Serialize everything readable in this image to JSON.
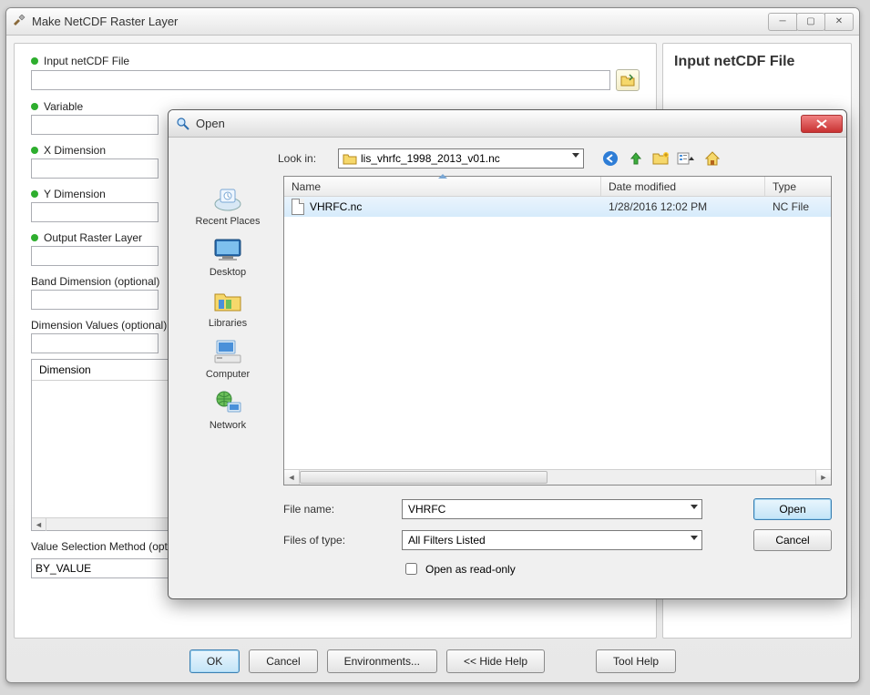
{
  "window": {
    "title": "Make NetCDF Raster Layer",
    "help_heading": "Input netCDF File"
  },
  "fields": {
    "input_file": {
      "label": "Input netCDF File",
      "value": ""
    },
    "variable": {
      "label": "Variable",
      "value": ""
    },
    "x_dim": {
      "label": "X Dimension",
      "value": ""
    },
    "y_dim": {
      "label": "Y Dimension",
      "value": ""
    },
    "output": {
      "label": "Output Raster Layer",
      "value": ""
    },
    "band_dim": {
      "label": "Band Dimension (optional)",
      "value": ""
    },
    "dim_values": {
      "label": "Dimension Values (optional)",
      "value": ""
    },
    "dim_header": "Dimension",
    "sel_method": {
      "label": "Value Selection Method (optional)",
      "value": "BY_VALUE"
    }
  },
  "buttons": {
    "ok": "OK",
    "cancel": "Cancel",
    "env": "Environments...",
    "hide": "<< Hide Help",
    "toolhelp": "Tool Help"
  },
  "dialog": {
    "title": "Open",
    "lookin_label": "Look in:",
    "lookin_value": "lis_vhrfc_1998_2013_v01.nc",
    "places": {
      "recent": "Recent Places",
      "desktop": "Desktop",
      "libraries": "Libraries",
      "computer": "Computer",
      "network": "Network"
    },
    "columns": {
      "name": "Name",
      "date": "Date modified",
      "type": "Type"
    },
    "rows": [
      {
        "name": "VHRFC.nc",
        "date": "1/28/2016 12:02 PM",
        "type": "NC File"
      }
    ],
    "filename_label": "File name:",
    "filename_value": "VHRFC",
    "filetype_label": "Files of type:",
    "filetype_value": "All Filters Listed",
    "readonly_label": "Open as read-only",
    "open_btn": "Open",
    "cancel_btn": "Cancel"
  }
}
